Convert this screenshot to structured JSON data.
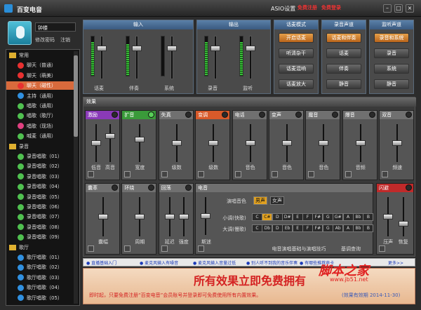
{
  "window": {
    "title": "百变电音",
    "asio": "ASIO设置",
    "reg": "免费注册",
    "login": "免费登录",
    "min": "–",
    "max": "□",
    "close": "×"
  },
  "user": {
    "name": "钟楼",
    "change_pw": "修改密码",
    "logout": "注销"
  },
  "tree": [
    {
      "type": "group",
      "label": "常用"
    },
    {
      "type": "item",
      "label": "聊天（普通）",
      "color": "#e83030"
    },
    {
      "type": "item",
      "label": "聊天（萌美）",
      "color": "#e83030"
    },
    {
      "type": "item",
      "label": "聊天（磁性）",
      "color": "#e83030",
      "selected": true
    },
    {
      "type": "item",
      "label": "主持（通用）",
      "color": "#3090e0"
    },
    {
      "type": "item",
      "label": "唱歌（通用）",
      "color": "#50c050"
    },
    {
      "type": "item",
      "label": "唱歌（歌厅）",
      "color": "#50c050"
    },
    {
      "type": "item",
      "label": "唱歌（现场）",
      "color": "#e04080"
    },
    {
      "type": "item",
      "label": "喊麦（通用）",
      "color": "#50c050"
    },
    {
      "type": "group",
      "label": "录音"
    },
    {
      "type": "item",
      "label": "录音唱歌（01）",
      "color": "#50c050"
    },
    {
      "type": "item",
      "label": "录音唱歌（02）",
      "color": "#50c050"
    },
    {
      "type": "item",
      "label": "录音唱歌（03）",
      "color": "#50c050"
    },
    {
      "type": "item",
      "label": "录音唱歌（04）",
      "color": "#50c050"
    },
    {
      "type": "item",
      "label": "录音唱歌（05）",
      "color": "#50c050"
    },
    {
      "type": "item",
      "label": "录音唱歌（06）",
      "color": "#50c050"
    },
    {
      "type": "item",
      "label": "录音唱歌（07）",
      "color": "#50c050"
    },
    {
      "type": "item",
      "label": "录音唱歌（08）",
      "color": "#50c050"
    },
    {
      "type": "item",
      "label": "录音唱歌（09）",
      "color": "#50c050"
    },
    {
      "type": "group",
      "label": "歌厅"
    },
    {
      "type": "item",
      "label": "歌厅唱歌（01）",
      "color": "#3090e0"
    },
    {
      "type": "item",
      "label": "歌厅唱歌（02）",
      "color": "#3090e0"
    },
    {
      "type": "item",
      "label": "歌厅唱歌（03）",
      "color": "#3090e0"
    },
    {
      "type": "item",
      "label": "歌厅唱歌（04）",
      "color": "#3090e0"
    },
    {
      "type": "item",
      "label": "歌厅唱歌（05）",
      "color": "#3090e0"
    }
  ],
  "input": {
    "title": "输入",
    "channels": [
      {
        "label": "话麦",
        "level": 0.85,
        "fader": 0.25
      },
      {
        "label": "伴奏",
        "level": 0.8,
        "fader": 0.25
      },
      {
        "label": "系统",
        "level": 0.0,
        "fader": 0.25
      }
    ]
  },
  "output": {
    "title": "输出",
    "channels": [
      {
        "label": "录音",
        "level": 0.85,
        "fader": 0.25
      },
      {
        "label": "监听",
        "level": 0.85,
        "fader": 0.25
      }
    ]
  },
  "mic_mode": {
    "title": "话麦模式",
    "buttons": [
      {
        "label": "开启话麦",
        "on": true
      },
      {
        "label": "听清杂干",
        "on": false
      },
      {
        "label": "话麦混响",
        "on": false
      },
      {
        "label": "话麦放大",
        "on": false
      }
    ]
  },
  "rec_channel": {
    "title": "录音声道",
    "buttons": [
      {
        "label": "话麦和伴奏",
        "on": true
      },
      {
        "label": "话麦",
        "on": false
      },
      {
        "label": "伴奏",
        "on": false
      },
      {
        "label": "静音",
        "on": false
      }
    ]
  },
  "mon_channel": {
    "title": "监听声道",
    "buttons": [
      {
        "label": "录音和系统",
        "on": true
      },
      {
        "label": "录音",
        "on": false
      },
      {
        "label": "系统",
        "on": false
      },
      {
        "label": "静音",
        "on": false
      }
    ]
  },
  "effects": {
    "title": "效果",
    "row1": [
      {
        "name": "激励",
        "color": "#8a3ab8",
        "power": false,
        "sliders": [
          {
            "label": "低音",
            "v": 0.5
          },
          {
            "label": "高音",
            "v": 0.3
          }
        ]
      },
      {
        "name": "扩音",
        "color": "#3a9a3a",
        "power": true,
        "sliders": [
          {
            "label": "宽度",
            "v": 0.4
          }
        ]
      },
      {
        "name": "失真",
        "color": "#707070",
        "power": false,
        "sliders": [
          {
            "label": "级数",
            "v": 0.5
          }
        ]
      },
      {
        "name": "变调",
        "color": "#d85a2a",
        "power": false,
        "sliders": [
          {
            "label": "级数",
            "v": 0.5
          }
        ]
      },
      {
        "name": "电话",
        "color": "#707070",
        "power": false,
        "sliders": [
          {
            "label": "音色",
            "v": 0.5
          }
        ]
      },
      {
        "name": "变声",
        "color": "#707070",
        "power": false,
        "sliders": [
          {
            "label": "音色",
            "v": 0.5
          }
        ]
      },
      {
        "name": "魔音",
        "color": "#707070",
        "power": false,
        "sliders": [
          {
            "label": "音色",
            "v": 0.5
          }
        ]
      },
      {
        "name": "爆音",
        "color": "#707070",
        "power": false,
        "sliders": [
          {
            "label": "音频",
            "v": 0.5
          }
        ]
      },
      {
        "name": "双音",
        "color": "#707070",
        "power": false,
        "sliders": [
          {
            "label": "频速",
            "v": 0.5
          }
        ]
      }
    ],
    "row2": [
      {
        "name": "囊萃",
        "color": "#707070",
        "power": false,
        "sliders": [
          {
            "label": "囊幅",
            "v": 0.5
          }
        ]
      },
      {
        "name": "环绕",
        "color": "#707070",
        "power": false,
        "sliders": [
          {
            "label": "周期",
            "v": 0.5
          }
        ]
      },
      {
        "name": "回荡",
        "color": "#707070",
        "power": false,
        "sliders": [
          {
            "label": "延迟",
            "v": 0.5
          },
          {
            "label": "强度",
            "v": 0.5
          }
        ]
      }
    ],
    "tone": {
      "name": "电音",
      "fader": "斯迷",
      "tone_label": "演唱音色",
      "male": "男声",
      "female": "女声",
      "major_label": "小调(快歌)",
      "minor_label": "大调(慢歌)",
      "major": [
        "C",
        "C#",
        "D",
        "D#",
        "E",
        "F",
        "F#",
        "G",
        "G#",
        "A",
        "Bb",
        "B"
      ],
      "minor": [
        "C",
        "Db",
        "D",
        "Eb",
        "E",
        "F",
        "F#",
        "G",
        "Ab",
        "A",
        "Bb",
        "B"
      ],
      "selected_major": "C#",
      "selected_minor": "",
      "hint1": "电音演唱基础与演唱技巧",
      "hint2": "基调查询"
    },
    "dodge": {
      "name": "闪避",
      "color": "#c02a2a",
      "sliders": [
        {
          "label": "压声",
          "v": 0.5
        },
        {
          "label": "恢复",
          "v": 0.7
        }
      ]
    }
  },
  "tips": [
    "直播基础入门",
    "麦克风输入有噪音",
    "麦克风输入音量过低",
    "别人听不到我的音乐伴奏",
    "有哪些推荐声卡"
  ],
  "tips_more": "更多>>",
  "promo": {
    "title": "所有效果立即免费拥有",
    "sub": "即时起，只要免费注册“百变电音”会员账号并登录即可免费使用所有内置效果。",
    "expiry": "(效果有效期 2014-11-30)"
  },
  "watermark": {
    "text": "脚本之家",
    "url": "www.jb51.net"
  }
}
